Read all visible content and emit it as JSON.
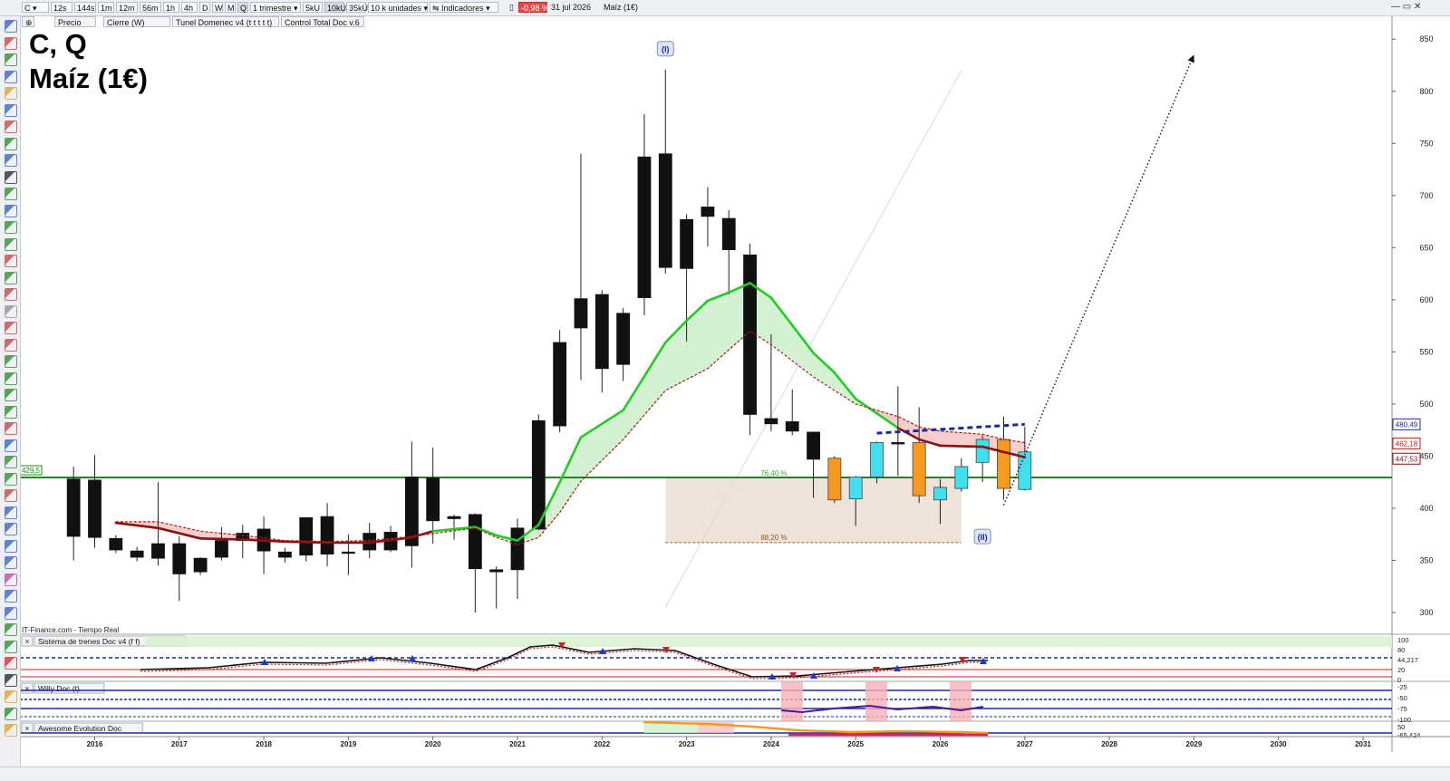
{
  "toolbar": {
    "symbol": "C",
    "buttons": [
      "12s",
      "144s",
      "1m",
      "12m",
      "56m",
      "1h",
      "4h",
      "D",
      "W",
      "M",
      "Q"
    ],
    "period": "1 trimestre",
    "unit_buttons": [
      "5kU",
      "10kU",
      "35kU"
    ],
    "units": "10 k unidades",
    "indicators": "Indicadores",
    "change": "-0,98 %",
    "date": "31 jul 2026",
    "name": "Maíz (1€)"
  },
  "legend": [
    "Precio",
    "Cierre (W)",
    "Tunel Domenec v4 (t t t t t)",
    "Control Total Doc v.6"
  ],
  "title": {
    "line1": "C, Q",
    "line2": "Maíz (1€)"
  },
  "source": "IT-Finance.com - Tiempo Real",
  "colors": {
    "up": "#000000",
    "aqua": "#40e0f0",
    "orange": "#f59a1e",
    "support": "#1a8a1a",
    "tunnel_up": "#22cc22",
    "tunnel_down": "#8b1010",
    "fib_zone": "#e8d8cc",
    "wave_label_bg": "#dde4f4",
    "wave_label": "#1a2a9a"
  },
  "chart_data": {
    "type": "candlestick",
    "x_axis": {
      "labels": [
        "2016",
        "2017",
        "2018",
        "2019",
        "2020",
        "2021",
        "2022",
        "2023",
        "2024",
        "2025",
        "2026",
        "2027",
        "2028",
        "2029",
        "2030",
        "2031"
      ]
    },
    "y_axis": {
      "ticks": [
        300,
        350,
        400,
        450,
        500,
        550,
        600,
        650,
        700,
        750,
        800,
        850
      ],
      "range": [
        280,
        860
      ]
    },
    "price_labels": [
      {
        "value": 480.49,
        "text": "480,49",
        "color": "#1a2a9a"
      },
      {
        "value": 462.18,
        "text": "462,18",
        "color": "#c81414"
      },
      {
        "value": 447.53,
        "text": "447,53",
        "color": "#8b1010"
      },
      {
        "value": 429.5,
        "text": "429,5",
        "color": "#1a8a1a"
      }
    ],
    "support_level": 429.5,
    "candles": [
      {
        "t": 2015.75,
        "o": 428,
        "h": 440,
        "l": 350,
        "c": 373,
        "color": "black"
      },
      {
        "t": 2016.0,
        "o": 427,
        "h": 451,
        "l": 362,
        "c": 372,
        "color": "black"
      },
      {
        "t": 2016.25,
        "o": 371,
        "h": 374,
        "l": 357,
        "c": 360,
        "color": "black"
      },
      {
        "t": 2016.5,
        "o": 359,
        "h": 363,
        "l": 349,
        "c": 353,
        "color": "black"
      },
      {
        "t": 2016.75,
        "o": 352,
        "h": 425,
        "l": 345,
        "c": 366,
        "color": "black"
      },
      {
        "t": 2017.0,
        "o": 366,
        "h": 373,
        "l": 311,
        "c": 337,
        "color": "black"
      },
      {
        "t": 2017.25,
        "o": 339,
        "h": 353,
        "l": 336,
        "c": 352,
        "color": "black"
      },
      {
        "t": 2017.5,
        "o": 353,
        "h": 382,
        "l": 350,
        "c": 369,
        "color": "black"
      },
      {
        "t": 2017.75,
        "o": 369,
        "h": 384,
        "l": 352,
        "c": 376,
        "color": "black"
      },
      {
        "t": 2018.0,
        "o": 380,
        "h": 392,
        "l": 337,
        "c": 359,
        "color": "black"
      },
      {
        "t": 2018.25,
        "o": 358,
        "h": 362,
        "l": 348,
        "c": 353,
        "color": "black"
      },
      {
        "t": 2018.5,
        "o": 355,
        "h": 390,
        "l": 349,
        "c": 391,
        "color": "black"
      },
      {
        "t": 2018.75,
        "o": 392,
        "h": 405,
        "l": 344,
        "c": 356,
        "color": "black"
      },
      {
        "t": 2019.0,
        "o": 358,
        "h": 375,
        "l": 336,
        "c": 358,
        "color": "black"
      },
      {
        "t": 2019.25,
        "o": 360,
        "h": 386,
        "l": 352,
        "c": 376,
        "color": "black"
      },
      {
        "t": 2019.5,
        "o": 377,
        "h": 383,
        "l": 358,
        "c": 360,
        "color": "black"
      },
      {
        "t": 2019.75,
        "o": 364,
        "h": 464,
        "l": 343,
        "c": 430,
        "color": "black"
      },
      {
        "t": 2020.0,
        "o": 429,
        "h": 458,
        "l": 366,
        "c": 388,
        "color": "black"
      },
      {
        "t": 2020.25,
        "o": 392,
        "h": 394,
        "l": 370,
        "c": 390,
        "color": "black"
      },
      {
        "t": 2020.5,
        "o": 394,
        "h": 395,
        "l": 300,
        "c": 342,
        "color": "black"
      },
      {
        "t": 2020.75,
        "o": 341,
        "h": 344,
        "l": 304,
        "c": 339,
        "color": "black"
      },
      {
        "t": 2021.0,
        "o": 341,
        "h": 390,
        "l": 313,
        "c": 381,
        "color": "black"
      },
      {
        "t": 2021.25,
        "o": 380,
        "h": 490,
        "l": 379,
        "c": 484,
        "color": "black"
      },
      {
        "t": 2021.5,
        "o": 479,
        "h": 571,
        "l": 473,
        "c": 559,
        "color": "black"
      },
      {
        "t": 2021.75,
        "o": 573,
        "h": 740,
        "l": 523,
        "c": 601,
        "color": "black"
      },
      {
        "t": 2022.0,
        "o": 605,
        "h": 609,
        "l": 511,
        "c": 534,
        "color": "black"
      },
      {
        "t": 2022.25,
        "o": 587,
        "h": 592,
        "l": 522,
        "c": 538,
        "color": "black"
      },
      {
        "t": 2022.5,
        "o": 602,
        "h": 778,
        "l": 585,
        "c": 737,
        "color": "black"
      },
      {
        "t": 2022.75,
        "o": 740,
        "h": 821,
        "l": 625,
        "c": 631,
        "color": "black"
      },
      {
        "t": 2023.0,
        "o": 677,
        "h": 682,
        "l": 560,
        "c": 630,
        "color": "black"
      },
      {
        "t": 2023.25,
        "o": 689,
        "h": 708,
        "l": 651,
        "c": 680,
        "color": "black"
      },
      {
        "t": 2023.5,
        "o": 678,
        "h": 686,
        "l": 605,
        "c": 648,
        "color": "black"
      },
      {
        "t": 2023.75,
        "o": 643,
        "h": 654,
        "l": 470,
        "c": 490,
        "color": "black"
      },
      {
        "t": 2024.0,
        "o": 486,
        "h": 567,
        "l": 474,
        "c": 481,
        "color": "black"
      },
      {
        "t": 2024.25,
        "o": 483,
        "h": 514,
        "l": 470,
        "c": 474,
        "color": "black"
      },
      {
        "t": 2024.5,
        "o": 473,
        "h": 473,
        "l": 410,
        "c": 447,
        "color": "black"
      },
      {
        "t": 2024.75,
        "o": 448,
        "h": 450,
        "l": 405,
        "c": 408,
        "color": "orange"
      },
      {
        "t": 2025.0,
        "o": 409,
        "h": 431,
        "l": 383,
        "c": 430,
        "color": "aqua"
      },
      {
        "t": 2025.25,
        "o": 430,
        "h": 464,
        "l": 424,
        "c": 463,
        "color": "aqua"
      },
      {
        "t": 2025.5,
        "o": 463,
        "h": 517,
        "l": 431,
        "c": 462,
        "color": "black"
      },
      {
        "t": 2025.75,
        "o": 463,
        "h": 497,
        "l": 405,
        "c": 412,
        "color": "orange"
      },
      {
        "t": 2026.0,
        "o": 408,
        "h": 428,
        "l": 385,
        "c": 420,
        "color": "aqua"
      },
      {
        "t": 2026.25,
        "o": 419,
        "h": 448,
        "l": 416,
        "c": 440,
        "color": "aqua"
      },
      {
        "t": 2026.5,
        "o": 444,
        "h": 470,
        "l": 425,
        "c": 466,
        "color": "aqua"
      },
      {
        "t": 2026.75,
        "o": 466,
        "h": 488,
        "l": 408,
        "c": 419,
        "color": "orange"
      },
      {
        "t": 2027.0,
        "o": 418,
        "h": 478,
        "l": 417,
        "c": 454,
        "color": "aqua"
      }
    ],
    "tunnel_main": [
      {
        "t": 2016.25,
        "v": 386
      },
      {
        "t": 2016.75,
        "v": 381
      },
      {
        "t": 2017.25,
        "v": 371
      },
      {
        "t": 2017.75,
        "v": 370
      },
      {
        "t": 2018.25,
        "v": 368
      },
      {
        "t": 2018.75,
        "v": 367
      },
      {
        "t": 2019.25,
        "v": 367
      },
      {
        "t": 2019.75,
        "v": 372
      },
      {
        "t": 2020.0,
        "v": 378
      },
      {
        "t": 2020.5,
        "v": 382
      },
      {
        "t": 2020.75,
        "v": 374
      },
      {
        "t": 2021.0,
        "v": 369
      },
      {
        "t": 2021.25,
        "v": 384
      },
      {
        "t": 2021.5,
        "v": 425
      },
      {
        "t": 2021.75,
        "v": 468
      },
      {
        "t": 2022.25,
        "v": 494
      },
      {
        "t": 2022.75,
        "v": 559
      },
      {
        "t": 2023.0,
        "v": 580
      },
      {
        "t": 2023.25,
        "v": 599
      },
      {
        "t": 2023.5,
        "v": 607
      },
      {
        "t": 2023.75,
        "v": 616
      },
      {
        "t": 2024.0,
        "v": 602
      },
      {
        "t": 2024.5,
        "v": 549
      },
      {
        "t": 2024.75,
        "v": 530
      },
      {
        "t": 2025.0,
        "v": 505
      },
      {
        "t": 2025.5,
        "v": 477
      },
      {
        "t": 2025.75,
        "v": 466
      },
      {
        "t": 2026.0,
        "v": 460
      },
      {
        "t": 2026.5,
        "v": 459
      },
      {
        "t": 2026.75,
        "v": 454
      },
      {
        "t": 2027.0,
        "v": 449
      }
    ],
    "tunnel_dashed": [
      {
        "t": 2016.25,
        "v": 387
      },
      {
        "t": 2016.75,
        "v": 387
      },
      {
        "t": 2017.25,
        "v": 378
      },
      {
        "t": 2017.75,
        "v": 374
      },
      {
        "t": 2018.25,
        "v": 369
      },
      {
        "t": 2018.75,
        "v": 368
      },
      {
        "t": 2019.25,
        "v": 369
      },
      {
        "t": 2019.75,
        "v": 373
      },
      {
        "t": 2020.5,
        "v": 381
      },
      {
        "t": 2020.75,
        "v": 372
      },
      {
        "t": 2021.0,
        "v": 365
      },
      {
        "t": 2021.25,
        "v": 372
      },
      {
        "t": 2021.5,
        "v": 396
      },
      {
        "t": 2021.75,
        "v": 426
      },
      {
        "t": 2022.25,
        "v": 466
      },
      {
        "t": 2022.75,
        "v": 513
      },
      {
        "t": 2023.25,
        "v": 534
      },
      {
        "t": 2023.75,
        "v": 570
      },
      {
        "t": 2024.0,
        "v": 557
      },
      {
        "t": 2024.5,
        "v": 526
      },
      {
        "t": 2024.75,
        "v": 513
      },
      {
        "t": 2025.0,
        "v": 500
      },
      {
        "t": 2025.5,
        "v": 488
      },
      {
        "t": 2025.75,
        "v": 478
      },
      {
        "t": 2026.0,
        "v": 474
      },
      {
        "t": 2026.5,
        "v": 471
      },
      {
        "t": 2026.75,
        "v": 466
      },
      {
        "t": 2027.0,
        "v": 463
      }
    ],
    "fib_zone": {
      "t0": 2022.75,
      "t1": 2026.25,
      "v_top": 429.5,
      "v_bottom": 367,
      "labels": [
        "76,40 %",
        "88,20 %"
      ]
    },
    "resistance_line": {
      "t0": 2025.25,
      "v0": 472,
      "t1": 2027.0,
      "v1": 480.5
    },
    "projection": {
      "t0": 2026.75,
      "v0": 403,
      "t1": 2029.0,
      "v1": 835
    },
    "guide_line": {
      "t0": 2022.75,
      "v0": 305,
      "t1": 2026.25,
      "v1": 820
    },
    "wave_labels": [
      {
        "text": "(I)",
        "t": 2022.75,
        "v": 840
      },
      {
        "text": "(II)",
        "t": 2026.5,
        "v": 372
      }
    ]
  },
  "panels": [
    {
      "name": "Sistema de trenes Doc v4 (f f)",
      "ticks": [
        "100",
        "80",
        "44,217",
        "20",
        "0"
      ]
    },
    {
      "name": "Willy Doc (t)",
      "ticks": [
        "-25",
        "-50",
        "-75",
        "-100"
      ]
    },
    {
      "name": "Awesome Evolution Doc",
      "ticks": [
        "50",
        "-65,424"
      ]
    }
  ]
}
